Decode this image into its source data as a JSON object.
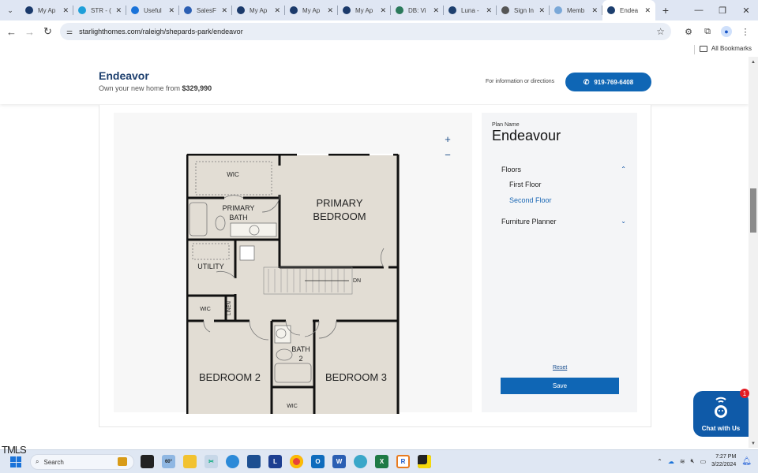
{
  "browser": {
    "tabs": [
      {
        "title": "My Ap",
        "icon": "circle-app-icon",
        "color": "#1b3a6b"
      },
      {
        "title": "STR - (",
        "icon": "salesforce-cloud-icon",
        "color": "#1f9fd9"
      },
      {
        "title": "Useful",
        "icon": "onedrive-cloud-icon",
        "color": "#1a73d9"
      },
      {
        "title": "SalesF",
        "icon": "word-doc-icon",
        "color": "#2b5fb3"
      },
      {
        "title": "My Ap",
        "icon": "circle-app-icon",
        "color": "#1b3a6b"
      },
      {
        "title": "My Ap",
        "icon": "circle-app-icon",
        "color": "#1b3a6b"
      },
      {
        "title": "My Ap",
        "icon": "circle-app-icon",
        "color": "#1b3a6b"
      },
      {
        "title": "DB: Vi",
        "icon": "gear-app-icon",
        "color": "#2b7a5b"
      },
      {
        "title": "Luna -",
        "icon": "star-logo-icon",
        "color": "#1d3f6e"
      },
      {
        "title": "Sign In",
        "icon": "globe-icon",
        "color": "#555555"
      },
      {
        "title": "Memb",
        "icon": "member-logo-icon",
        "color": "#7aa8d8"
      },
      {
        "title": "Endea",
        "icon": "star-logo-icon",
        "color": "#1d3f6e",
        "active": true
      }
    ],
    "new_tab": "+",
    "url": "starlighthomes.com/raleigh/shepards-park/endeavor",
    "bookmarks_label": "All Bookmarks"
  },
  "header": {
    "title": "Endeavor",
    "subtitle_prefix": "Own your new home from ",
    "price": "$329,990",
    "info_text": "For information or directions",
    "phone": "919-769-6408"
  },
  "floorplan": {
    "zoom_in": "+",
    "zoom_out": "−",
    "rooms": {
      "wic_top": "WIC",
      "primary_bath_1": "PRIMARY",
      "primary_bath_2": "BATH",
      "primary_bed_1": "PRIMARY",
      "primary_bed_2": "BEDROOM",
      "utility": "UTILITY",
      "dn": "DN",
      "wic_left": "WIC",
      "linen": "LINEN",
      "bath2_1": "BATH",
      "bath2_2": "2",
      "bedroom2": "BEDROOM 2",
      "bedroom3": "BEDROOM 3",
      "wic_bottom": "WIC"
    }
  },
  "sidebar": {
    "plan_label": "Plan Name",
    "plan_name": "Endeavour",
    "floors_label": "Floors",
    "floors": [
      {
        "label": "First Floor",
        "selected": false
      },
      {
        "label": "Second Floor",
        "selected": true
      }
    ],
    "furniture_label": "Furniture Planner",
    "reset_label": "Reset",
    "save_label": "Save"
  },
  "chat": {
    "label": "Chat with Us",
    "badge": "1"
  },
  "overlay_text": "TMLS",
  "taskbar": {
    "search_placeholder": "Search",
    "weather": "60°",
    "time": "7:27 PM",
    "date": "3/22/2024"
  },
  "colors": {
    "brand_blue": "#0f66b5",
    "title_navy": "#1d3f6e",
    "selected_link": "#1a67b4"
  }
}
